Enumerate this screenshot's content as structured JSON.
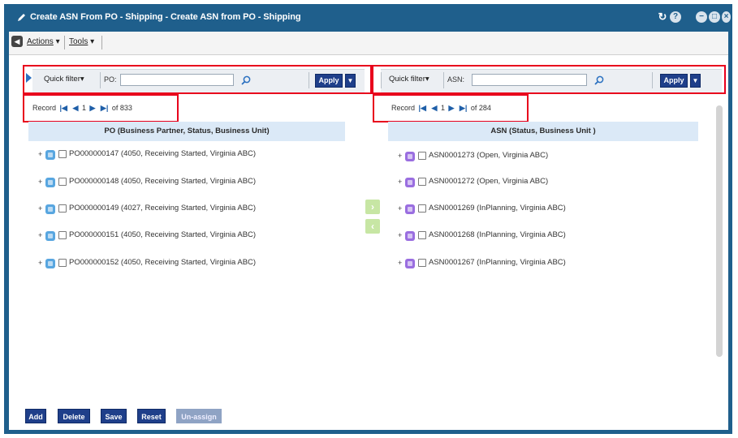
{
  "window": {
    "title": "Create ASN From PO - Shipping - Create ASN from PO - Shipping",
    "controls": [
      "refresh-icon",
      "help-icon",
      "minimize-icon",
      "maximize-icon",
      "close-icon"
    ]
  },
  "menu": {
    "actions_label": "Actions",
    "tools_label": "Tools"
  },
  "left_filter": {
    "quick_filter_label": "Quick filter",
    "field_label": "PO:",
    "field_value": "",
    "apply_label": "Apply"
  },
  "right_filter": {
    "quick_filter_label": "Quick filter",
    "field_label": "ASN:",
    "field_value": "",
    "apply_label": "Apply"
  },
  "left_record": {
    "label": "Record",
    "current": "1",
    "of_label": "of",
    "total": "833"
  },
  "right_record": {
    "label": "Record",
    "current": "1",
    "of_label": "of",
    "total": "284"
  },
  "left_header": "PO (Business Partner, Status, Business Unit)",
  "right_header": "ASN (Status, Business Unit )",
  "po_items": [
    "PO000000147 (4050, Receiving Started, Virginia ABC)",
    "PO000000148 (4050, Receiving Started, Virginia ABC)",
    "PO000000149 (4027, Receiving Started, Virginia ABC)",
    "PO000000151 (4050, Receiving Started, Virginia ABC)",
    "PO000000152 (4050, Receiving Started, Virginia ABC)"
  ],
  "asn_items": [
    "ASN0001273 (Open, Virginia ABC)",
    "ASN0001272 (Open, Virginia ABC)",
    "ASN0001269 (InPlanning, Virginia ABC)",
    "ASN0001268 (InPlanning, Virginia ABC)",
    "ASN0001267 (InPlanning, Virginia ABC)"
  ],
  "buttons": {
    "add": "Add",
    "delete": "Delete",
    "save": "Save",
    "reset": "Reset",
    "unassign": "Un-assign"
  },
  "colors": {
    "title_bar": "#1f5f8c",
    "header_bg": "#dbe9f7",
    "button_bg": "#1f3f8a",
    "highlight_red": "#e8001c",
    "po_icon": "#58a6e0",
    "asn_icon": "#9a6ee0",
    "move_btn": "#c7e6a4"
  }
}
